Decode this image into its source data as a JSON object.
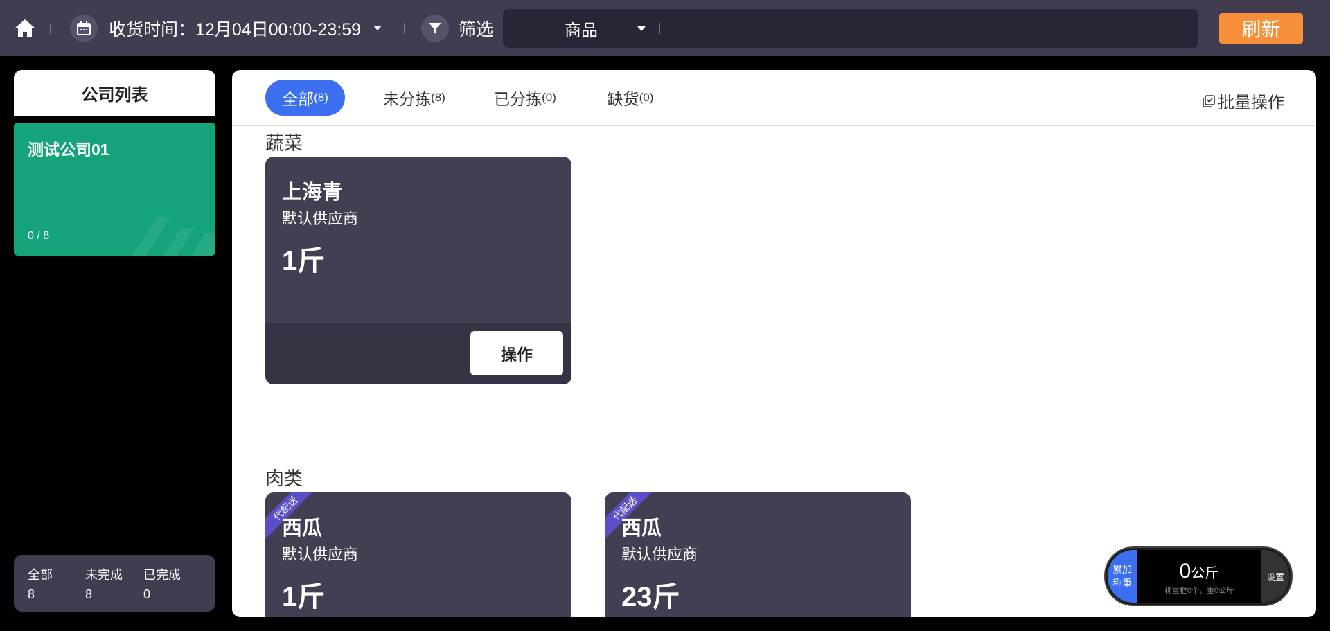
{
  "topbar": {
    "receive_time_label": "收货时间：",
    "receive_time_value": "12月04日00:00-23:59",
    "filter_label": "筛选",
    "search_category": "商品",
    "search_value": "",
    "refresh_label": "刷新"
  },
  "sidebar": {
    "title": "公司列表",
    "companies": [
      {
        "name": "测试公司01",
        "progress": "0 / 8"
      }
    ],
    "summary": {
      "all_label": "全部",
      "all_value": "8",
      "incomplete_label": "未完成",
      "incomplete_value": "8",
      "complete_label": "已完成",
      "complete_value": "0"
    }
  },
  "tabs": [
    {
      "label": "全部",
      "count": "(8)"
    },
    {
      "label": "未分拣",
      "count": "(8)"
    },
    {
      "label": "已分拣",
      "count": "(0)"
    },
    {
      "label": "缺货",
      "count": "(0)"
    }
  ],
  "batch_label": "批量操作",
  "sections": [
    {
      "title": "蔬菜",
      "items": [
        {
          "name": "上海青",
          "supplier": "默认供应商",
          "qty": "1斤",
          "button": "操作"
        }
      ]
    },
    {
      "title": "肉类",
      "items": [
        {
          "badge": "代配送",
          "name": "西瓜",
          "supplier": "默认供应商",
          "qty": "1斤"
        },
        {
          "badge": "代配送",
          "name": "西瓜",
          "supplier": "默认供应商",
          "qty": "23斤"
        }
      ]
    }
  ],
  "scale": {
    "left_line1": "累加",
    "left_line2": "称重",
    "value": "0",
    "unit": "公斤",
    "sub": "称重框0个，重0公斤",
    "settings": "设置"
  },
  "colors": {
    "topbar_bg": "#3f3d4f",
    "accent_blue": "#3b6ff0",
    "refresh_orange": "#f58f3a",
    "company_green": "#14a37a",
    "card_bg": "#413f51",
    "badge_purple": "#5a4fc7"
  }
}
